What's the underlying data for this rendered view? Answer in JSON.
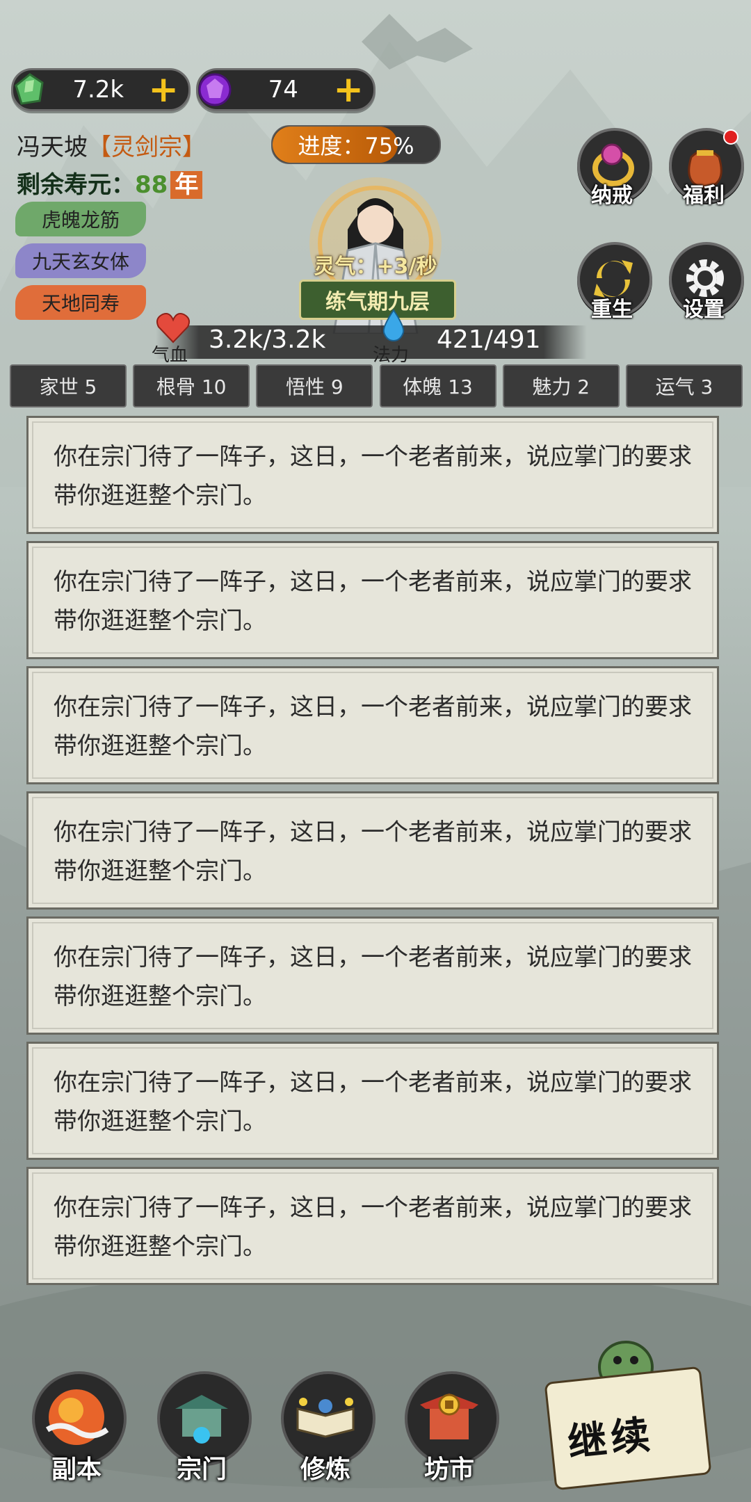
{
  "currency": {
    "spirit_stone": "7.2k",
    "purple_gem": "74",
    "plus": "+"
  },
  "player": {
    "name": "冯天坡",
    "sect": "【灵剑宗】",
    "life_label": "剩余寿元：",
    "life_value": "88",
    "life_unit": "年",
    "tags": [
      "虎魄龙筋",
      "九天玄女体",
      "天地同寿"
    ]
  },
  "progress": {
    "label": "进度：75%",
    "value": 0.75
  },
  "cultivation": {
    "lingqi": "灵气：+3/秒",
    "realm": "练气期九层"
  },
  "vitals": {
    "hp_label": "气血",
    "hp_value": "3.2k/3.2k",
    "mp_label": "法力",
    "mp_value": "421/491"
  },
  "side_buttons": {
    "ring": "纳戒",
    "welfare": "福利",
    "rebirth": "重生",
    "settings": "设置"
  },
  "attributes": [
    "家世 5",
    "根骨 10",
    "悟性 9",
    "体魄 13",
    "魅力 2",
    "运气 3"
  ],
  "log": [
    "你在宗门待了一阵子，这日，一个老者前来，说应掌门的要求带你逛逛整个宗门。",
    "你在宗门待了一阵子，这日，一个老者前来，说应掌门的要求带你逛逛整个宗门。",
    "你在宗门待了一阵子，这日，一个老者前来，说应掌门的要求带你逛逛整个宗门。",
    "你在宗门待了一阵子，这日，一个老者前来，说应掌门的要求带你逛逛整个宗门。",
    "你在宗门待了一阵子，这日，一个老者前来，说应掌门的要求带你逛逛整个宗门。",
    "你在宗门待了一阵子，这日，一个老者前来，说应掌门的要求带你逛逛整个宗门。",
    "你在宗门待了一阵子，这日，一个老者前来，说应掌门的要求带你逛逛整个宗门。"
  ],
  "nav": {
    "dungeon": "副本",
    "sect": "宗门",
    "cultivate": "修炼",
    "market": "坊市",
    "continue": "继续"
  },
  "colors": {
    "accent_orange": "#d96b2b",
    "realm_green": "#3d5f2f",
    "log_bg": "#e6e5da"
  }
}
